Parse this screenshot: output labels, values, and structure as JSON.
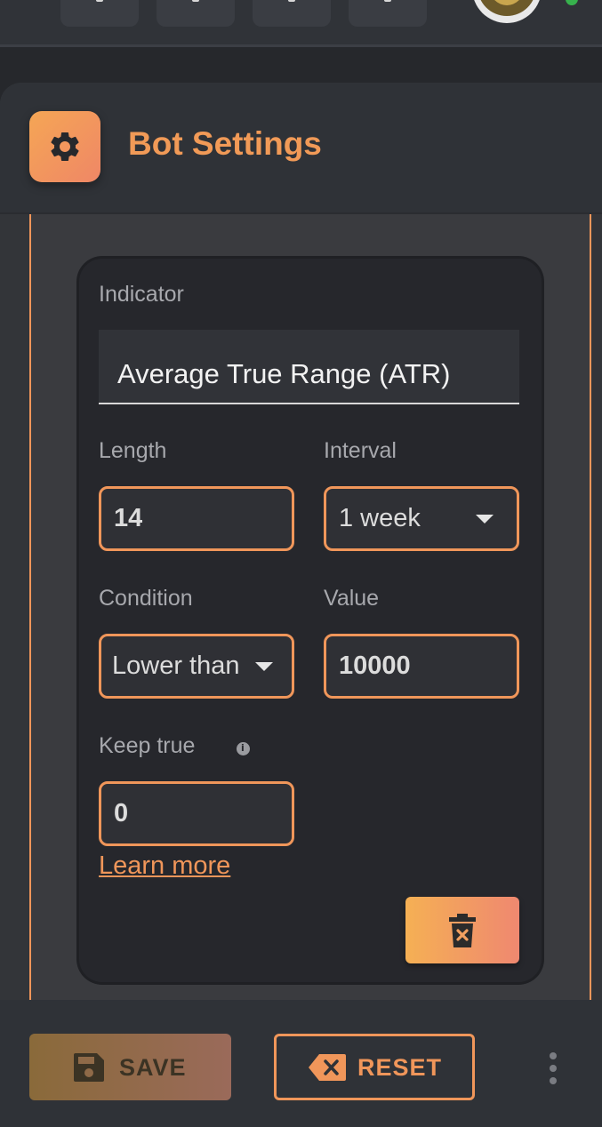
{
  "header": {
    "title": "Bot Settings",
    "icon": "gear-icon"
  },
  "condition_card": {
    "indicator": {
      "label": "Indicator",
      "value": "Average True Range (ATR)"
    },
    "length": {
      "label": "Length",
      "value": "14"
    },
    "interval": {
      "label": "Interval",
      "value": "1 week"
    },
    "condition": {
      "label": "Condition",
      "value": "Lower than"
    },
    "value": {
      "label": "Value",
      "value": "10000"
    },
    "keep_true": {
      "label": "Keep true",
      "value": "0"
    },
    "learn_more": "Learn more",
    "delete_icon": "trash-x-icon"
  },
  "footer": {
    "save_label": "SAVE",
    "reset_label": "RESET"
  },
  "colors": {
    "accent": "#f0965a",
    "gradient_start": "#f5b054",
    "gradient_end": "#ef8870",
    "panel": "#333539",
    "card": "#26272c",
    "online": "#37b24d"
  }
}
